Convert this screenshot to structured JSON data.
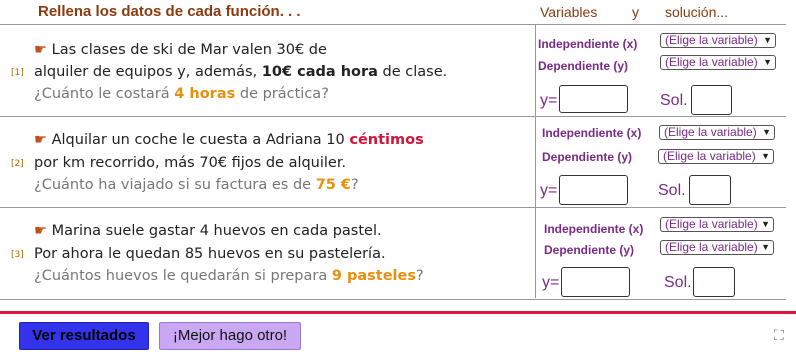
{
  "header": {
    "title": "Rellena los datos de cada función. . .",
    "col_variables": "Variables",
    "col_y": "y",
    "col_solucion": "solución..."
  },
  "problems": [
    {
      "num": "[1]",
      "line1_pre": "Las clases de ski de Mar valen 30€ de",
      "line2_pre": "alquiler de equipos y, además, ",
      "line2_em": "10€ cada hora",
      "line2_post": " de clase.",
      "line3_pre": "¿Cuánto le costará ",
      "line3_em": "4 horas",
      "line3_post": " de práctica?",
      "label_indep": "Independiente (x)",
      "label_dep": "Dependiente (y)",
      "select_indep": "(Elige la variable)",
      "select_dep": "(Elige la variable)",
      "y_label": "y=",
      "sol_label": "Sol."
    },
    {
      "num": "[2]",
      "line1_pre": "Alquilar un coche le cuesta a Adriana 10 ",
      "line1_em": "céntimos",
      "line2_pre": "por km recorrido, más 70€ fijos de alquiler.",
      "line3_pre": "¿Cuánto ha viajado si su factura es de ",
      "line3_em": "75 €",
      "line3_post": "?",
      "label_indep": "Independiente (x)",
      "label_dep": "Dependiente (y)",
      "select_indep": "(Elige la variable)",
      "select_dep": "(Elige la variable)",
      "y_label": "y=",
      "sol_label": "Sol."
    },
    {
      "num": "[3]",
      "line1_pre": "Marina suele gastar 4 huevos en cada pastel.",
      "line2_pre": "Por ahora le quedan 85 huevos en su pastelería.",
      "line3_pre": "¿Cuántos huevos le quedarán si prepara ",
      "line3_em": "9 pasteles",
      "line3_post": "?",
      "label_indep": "Independiente (x)",
      "label_dep": "Dependiente (y)",
      "select_indep": "(Elige la variable)",
      "select_dep": "(Elige la variable)",
      "y_label": "y=",
      "sol_label": "Sol."
    }
  ],
  "buttons": {
    "results": "Ver resultados",
    "other": "¡Mejor hago otro!"
  },
  "icons": {
    "hand": "☛",
    "fullscreen": "⛶"
  },
  "colors": {
    "accent_red": "#e0143c",
    "btn_blue": "#3333ee",
    "btn_lilac": "#c9a7f2",
    "label_purple": "#7a2a87"
  }
}
